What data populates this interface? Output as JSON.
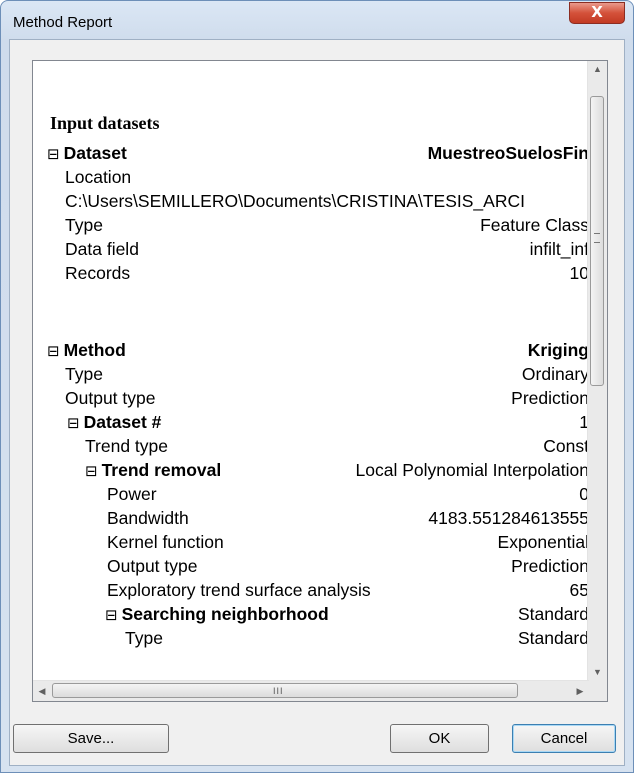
{
  "window": {
    "title": "Method Report",
    "close_glyph": "X"
  },
  "report": {
    "heading": "Input datasets",
    "dataset": {
      "label": "Dataset",
      "value": "MuestreoSuelosFin",
      "location_label": "Location",
      "location_value": "C:\\Users\\SEMILLERO\\Documents\\CRISTINA\\TESIS_ARCI",
      "rows": [
        {
          "label": "Type",
          "value": "Feature Class"
        },
        {
          "label": "Data field",
          "value": "infilt_inf"
        },
        {
          "label": "Records",
          "value": "10"
        }
      ]
    },
    "method": {
      "label": "Method",
      "value": "Kriging",
      "rows": [
        {
          "label": "Type",
          "value": "Ordinary"
        },
        {
          "label": "Output type",
          "value": "Prediction"
        }
      ],
      "dataset_num": {
        "label": "Dataset #",
        "value": "1"
      },
      "trend_type": {
        "label": "Trend type",
        "value": "Const"
      },
      "trend_removal": {
        "label": "Trend removal",
        "value": "Local Polynomial Interpolation"
      },
      "trend_rows": [
        {
          "label": "Power",
          "value": "0"
        },
        {
          "label": "Bandwidth",
          "value": "4183.551284613555"
        },
        {
          "label": "Kernel function",
          "value": "Exponential"
        },
        {
          "label": "Output type",
          "value": "Prediction"
        },
        {
          "label": "Exploratory trend surface analysis",
          "value": "65"
        }
      ],
      "searching": {
        "label": "Searching neighborhood",
        "value": "Standard"
      },
      "searching_rows": [
        {
          "label": "Type",
          "value": "Standard"
        }
      ]
    }
  },
  "icons": {
    "toggle": "collapse-toggle-icon",
    "hgrip": "III"
  },
  "buttons": {
    "save": "Save...",
    "ok": "OK",
    "cancel": "Cancel"
  },
  "colors": {
    "title_close": "#c23a23",
    "default_button_border": "#3c7fb1"
  }
}
